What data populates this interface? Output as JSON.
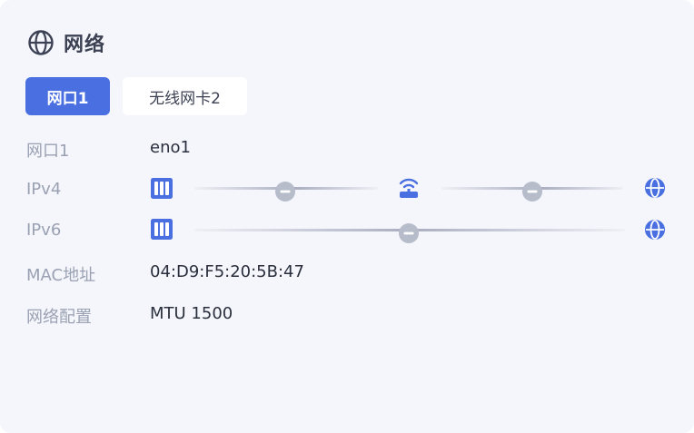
{
  "panel": {
    "title": "网络",
    "title_icon": "globe-icon"
  },
  "tabs": [
    {
      "label": "网口1",
      "active": true
    },
    {
      "label": "无线网卡2",
      "active": false
    }
  ],
  "rows": {
    "port": {
      "label": "网口1",
      "value": "eno1"
    },
    "ipv4": {
      "label": "IPv4",
      "icons": [
        "server-icon",
        "status-minus-icon",
        "router-wifi-icon",
        "status-minus-icon",
        "globe-icon"
      ]
    },
    "ipv6": {
      "label": "IPv6",
      "icons": [
        "server-icon",
        "status-minus-icon",
        "globe-icon"
      ]
    },
    "mac": {
      "label": "MAC地址",
      "value": "04:D9:F5:20:5B:47"
    },
    "config": {
      "label": "网络配置",
      "value": "MTU 1500"
    }
  },
  "colors": {
    "accent": "#4a6fe0",
    "label_gray": "#9aa1b3",
    "status_gray": "#b7bccb",
    "background": "#f5f6fb"
  }
}
